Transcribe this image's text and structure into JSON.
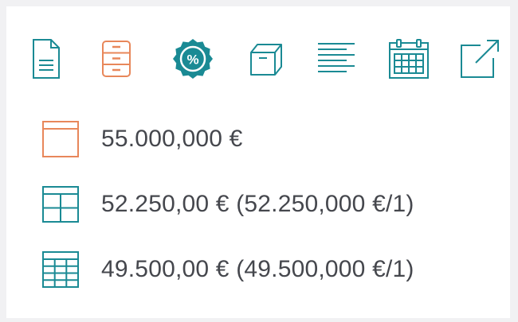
{
  "colors": {
    "teal": "#1a8a94",
    "orange": "#e8875a",
    "text": "#45474d",
    "background": "#ffffff",
    "outer": "#f1f1f3"
  },
  "toolbar": {
    "items": [
      {
        "name": "document",
        "icon": "document-icon"
      },
      {
        "name": "filing-cabinet",
        "icon": "filing-cabinet-icon"
      },
      {
        "name": "discount",
        "icon": "discount-badge-icon",
        "symbol": "%"
      },
      {
        "name": "box",
        "icon": "box-icon"
      },
      {
        "name": "text-align",
        "icon": "text-lines-icon"
      },
      {
        "name": "calendar",
        "icon": "calendar-icon"
      },
      {
        "name": "external-link",
        "icon": "external-link-icon"
      }
    ]
  },
  "prices": [
    {
      "icon": "single-panel-icon",
      "text": "55.000,000 €"
    },
    {
      "icon": "grid-2x2-icon",
      "text": "52.250,00 € (52.250,000 €/1)"
    },
    {
      "icon": "grid-3x4-icon",
      "text": "49.500,00 € (49.500,000 €/1)"
    }
  ]
}
